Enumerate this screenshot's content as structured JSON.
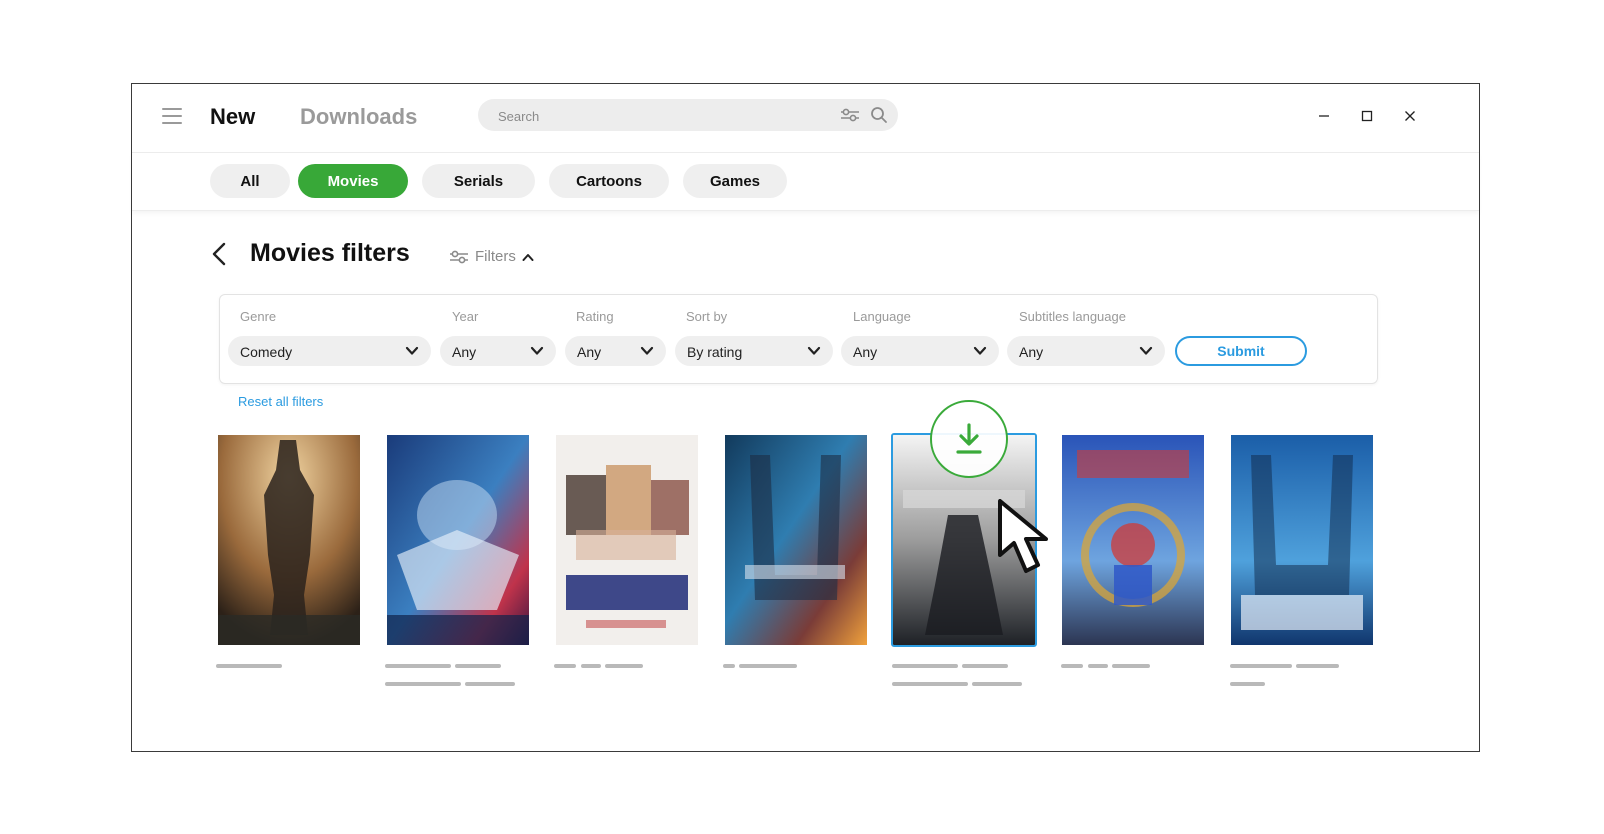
{
  "topbar": {
    "nav_new": "New",
    "nav_downloads": "Downloads",
    "search_placeholder": "Search",
    "icons": [
      "menu-icon",
      "filter-sliders-icon",
      "search-icon",
      "minimize-icon",
      "maximize-icon",
      "close-icon"
    ]
  },
  "tabs": [
    {
      "label": "All",
      "active": false
    },
    {
      "label": "Movies",
      "active": true
    },
    {
      "label": "Serials",
      "active": false
    },
    {
      "label": "Cartoons",
      "active": false
    },
    {
      "label": "Games",
      "active": false
    }
  ],
  "heading": {
    "title": "Movies filters",
    "filters_toggle": "Filters"
  },
  "filters": {
    "genre": {
      "label": "Genre",
      "value": "Comedy"
    },
    "year": {
      "label": "Year",
      "value": "Any"
    },
    "rating": {
      "label": "Rating",
      "value": "Any"
    },
    "sort_by": {
      "label": "Sort by",
      "value": "By rating"
    },
    "language": {
      "label": "Language",
      "value": "Any"
    },
    "subtitles": {
      "label": "Subtitles language",
      "value": "Any"
    },
    "submit_label": "Submit",
    "reset_label": "Reset all filters"
  },
  "colors": {
    "accent_green": "#38a838",
    "accent_blue": "#2b9be0"
  },
  "posters": [
    {
      "theme": "dark silhouette, sepia",
      "selected": false
    },
    {
      "theme": "blue and red space",
      "selected": false
    },
    {
      "theme": "white collage",
      "selected": false
    },
    {
      "theme": "blue orange nebula",
      "selected": false
    },
    {
      "theme": "gray monochrome",
      "selected": true
    },
    {
      "theme": "blue superhero",
      "selected": false
    },
    {
      "theme": "blue underwater",
      "selected": false
    }
  ]
}
